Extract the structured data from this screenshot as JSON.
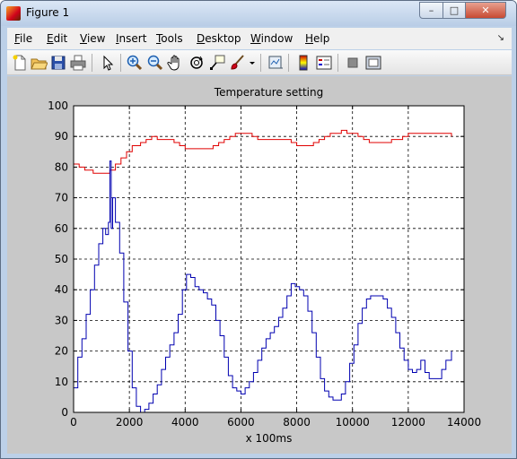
{
  "window": {
    "title": "Figure 1",
    "buttons": {
      "minimize": "–",
      "maximize": "□",
      "close": "✕"
    }
  },
  "menu": [
    {
      "label": "File",
      "key": "F",
      "rest": "ile"
    },
    {
      "label": "Edit",
      "key": "E",
      "rest": "dit"
    },
    {
      "label": "View",
      "key": "V",
      "rest": "iew"
    },
    {
      "label": "Insert",
      "key": "I",
      "rest": "nsert"
    },
    {
      "label": "Tools",
      "key": "T",
      "rest": "ools"
    },
    {
      "label": "Desktop",
      "key": "D",
      "rest": "esktop"
    },
    {
      "label": "Window",
      "key": "W",
      "rest": "indow"
    },
    {
      "label": "Help",
      "key": "H",
      "rest": "elp"
    }
  ],
  "toolbar_icons": [
    "new-figure-icon",
    "open-file-icon",
    "save-icon",
    "print-icon",
    "edit-plot-arrow-icon",
    "zoom-in-icon",
    "zoom-out-icon",
    "pan-hand-icon",
    "rotate-3d-icon",
    "data-cursor-icon",
    "brush-icon",
    "link-plot-icon",
    "insert-colorbar-icon",
    "insert-legend-icon",
    "hide-plot-tools-icon",
    "show-plot-tools-icon"
  ],
  "colors": {
    "titlebar": "#c7d8ee",
    "figure_bg": "#c8c8c8",
    "axes_bg": "#ffffff",
    "series_red": "#e00000",
    "series_blue": "#0000b0"
  },
  "chart_data": {
    "type": "line",
    "title": "Temperature setting",
    "xlabel": "x 100ms",
    "ylabel": "",
    "xlim": [
      0,
      14000
    ],
    "ylim": [
      0,
      100
    ],
    "xticks": [
      0,
      2000,
      4000,
      6000,
      8000,
      10000,
      12000,
      14000
    ],
    "yticks": [
      0,
      10,
      20,
      30,
      40,
      50,
      60,
      70,
      80,
      90,
      100
    ],
    "grid": true,
    "series": [
      {
        "color": "red",
        "x": [
          0,
          200,
          400,
          700,
          1000,
          1200,
          1300,
          1500,
          1700,
          1900,
          2100,
          2400,
          2600,
          2800,
          3000,
          3200,
          3400,
          3600,
          3800,
          4000,
          4200,
          4400,
          4600,
          4800,
          5000,
          5200,
          5400,
          5600,
          5800,
          6000,
          6200,
          6400,
          6600,
          6800,
          7000,
          7200,
          7400,
          7600,
          7800,
          8000,
          8200,
          8400,
          8600,
          8800,
          9000,
          9200,
          9400,
          9600,
          9800,
          10000,
          10200,
          10400,
          10600,
          10800,
          11000,
          11200,
          11400,
          11600,
          11800,
          12000,
          12200,
          12400,
          12600,
          12800,
          13000,
          13200,
          13400,
          13550
        ],
        "y": [
          81,
          80,
          79,
          78,
          78,
          78,
          79,
          81,
          83,
          85,
          87,
          88,
          89,
          90,
          89,
          89,
          89,
          88,
          87,
          86,
          86,
          86,
          86,
          86,
          87,
          88,
          89,
          90,
          91,
          91,
          91,
          90,
          89,
          89,
          89,
          89,
          89,
          89,
          88,
          87,
          87,
          87,
          88,
          89,
          90,
          91,
          91,
          92,
          91,
          91,
          90,
          89,
          88,
          88,
          88,
          88,
          89,
          89,
          90,
          91,
          91,
          91,
          91,
          91,
          91,
          91,
          91,
          90
        ]
      },
      {
        "color": "blue",
        "x": [
          0,
          150,
          300,
          450,
          600,
          750,
          900,
          1050,
          1150,
          1250,
          1300,
          1350,
          1400,
          1500,
          1650,
          1800,
          1950,
          2100,
          2250,
          2400,
          2550,
          2700,
          2850,
          3000,
          3150,
          3300,
          3450,
          3600,
          3750,
          3900,
          4050,
          4200,
          4350,
          4500,
          4650,
          4800,
          4950,
          5100,
          5250,
          5400,
          5550,
          5700,
          5850,
          6000,
          6150,
          6300,
          6450,
          6600,
          6750,
          6900,
          7050,
          7200,
          7350,
          7500,
          7650,
          7800,
          7950,
          8100,
          8250,
          8400,
          8550,
          8700,
          8850,
          9000,
          9150,
          9300,
          9450,
          9600,
          9750,
          9900,
          10050,
          10200,
          10350,
          10500,
          10650,
          10800,
          10950,
          11100,
          11250,
          11400,
          11550,
          11700,
          11850,
          12000,
          12150,
          12300,
          12450,
          12600,
          12750,
          12900,
          13050,
          13200,
          13350,
          13550
        ],
        "y": [
          8,
          18,
          24,
          32,
          40,
          48,
          55,
          60,
          58,
          62,
          82,
          60,
          70,
          62,
          52,
          36,
          20,
          8,
          2,
          0,
          1,
          3,
          6,
          9,
          14,
          18,
          22,
          26,
          32,
          40,
          45,
          44,
          41,
          40,
          39,
          37,
          35,
          30,
          25,
          18,
          12,
          8,
          7,
          6,
          8,
          10,
          13,
          17,
          21,
          24,
          26,
          28,
          31,
          34,
          38,
          42,
          41,
          40,
          38,
          33,
          26,
          18,
          11,
          7,
          5,
          4,
          4,
          6,
          10,
          16,
          22,
          29,
          34,
          37,
          38,
          38,
          38,
          37,
          34,
          31,
          26,
          21,
          17,
          14,
          13,
          14,
          17,
          13,
          11,
          11,
          11,
          14,
          17,
          20
        ]
      }
    ]
  }
}
